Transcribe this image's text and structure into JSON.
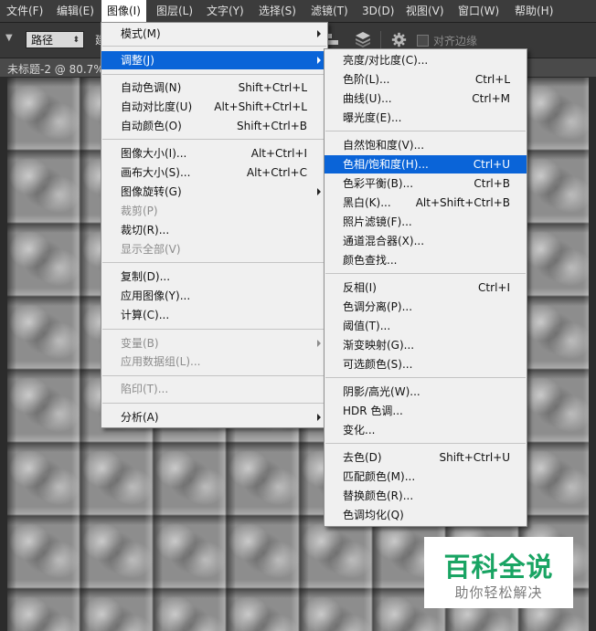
{
  "menubar": {
    "items": [
      "文件(F)",
      "编辑(E)",
      "图像(I)",
      "图层(L)",
      "文字(Y)",
      "选择(S)",
      "滤镜(T)",
      "3D(D)",
      "视图(V)",
      "窗口(W)",
      "帮助(H)"
    ]
  },
  "options_bar": {
    "path_mode": "路径",
    "truncated_label": "建",
    "align_edges_label": "对齐边缘"
  },
  "document_tab": {
    "label": "未标题-2 @ 80.7%"
  },
  "image_menu": {
    "mode": "模式(M)",
    "adjustments": "调整(J)",
    "auto_tone": {
      "label": "自动色调(N)",
      "shortcut": "Shift+Ctrl+L"
    },
    "auto_contrast": {
      "label": "自动对比度(U)",
      "shortcut": "Alt+Shift+Ctrl+L"
    },
    "auto_color": {
      "label": "自动颜色(O)",
      "shortcut": "Shift+Ctrl+B"
    },
    "image_size": {
      "label": "图像大小(I)...",
      "shortcut": "Alt+Ctrl+I"
    },
    "canvas_size": {
      "label": "画布大小(S)...",
      "shortcut": "Alt+Ctrl+C"
    },
    "image_rotation": "图像旋转(G)",
    "crop": "裁剪(P)",
    "trim": "裁切(R)...",
    "reveal_all": "显示全部(V)",
    "duplicate": "复制(D)...",
    "apply_image": "应用图像(Y)...",
    "calculations": "计算(C)...",
    "variables": "变量(B)",
    "apply_data_set": "应用数据组(L)...",
    "trap": "陷印(T)...",
    "analysis": "分析(A)"
  },
  "adjust_menu": {
    "brightness_contrast": {
      "label": "亮度/对比度(C)...",
      "shortcut": ""
    },
    "levels": {
      "label": "色阶(L)...",
      "shortcut": "Ctrl+L"
    },
    "curves": {
      "label": "曲线(U)...",
      "shortcut": "Ctrl+M"
    },
    "exposure": {
      "label": "曝光度(E)...",
      "shortcut": ""
    },
    "vibrance": {
      "label": "自然饱和度(V)...",
      "shortcut": ""
    },
    "hue_saturation": {
      "label": "色相/饱和度(H)...",
      "shortcut": "Ctrl+U"
    },
    "color_balance": {
      "label": "色彩平衡(B)...",
      "shortcut": "Ctrl+B"
    },
    "black_white": {
      "label": "黑白(K)...",
      "shortcut": "Alt+Shift+Ctrl+B"
    },
    "photo_filter": {
      "label": "照片滤镜(F)...",
      "shortcut": ""
    },
    "channel_mixer": {
      "label": "通道混合器(X)...",
      "shortcut": ""
    },
    "color_lookup": {
      "label": "颜色查找...",
      "shortcut": ""
    },
    "invert": {
      "label": "反相(I)",
      "shortcut": "Ctrl+I"
    },
    "posterize": {
      "label": "色调分离(P)...",
      "shortcut": ""
    },
    "threshold": {
      "label": "阈值(T)...",
      "shortcut": ""
    },
    "gradient_map": {
      "label": "渐变映射(G)...",
      "shortcut": ""
    },
    "selective_color": {
      "label": "可选颜色(S)...",
      "shortcut": ""
    },
    "shadows_highlights": {
      "label": "阴影/高光(W)...",
      "shortcut": ""
    },
    "hdr_toning": {
      "label": "HDR 色调...",
      "shortcut": ""
    },
    "variations": {
      "label": "变化...",
      "shortcut": ""
    },
    "desaturate": {
      "label": "去色(D)",
      "shortcut": "Shift+Ctrl+U"
    },
    "match_color": {
      "label": "匹配颜色(M)...",
      "shortcut": ""
    },
    "replace_color": {
      "label": "替换颜色(R)...",
      "shortcut": ""
    },
    "equalize": {
      "label": "色调均化(Q)",
      "shortcut": ""
    }
  },
  "watermark": {
    "title": "百科全说",
    "subtitle": "助你轻松解决"
  },
  "colors": {
    "highlight": "#0a64d8",
    "menu_bg": "#f0f0f0",
    "watermark_green": "#19a463"
  }
}
